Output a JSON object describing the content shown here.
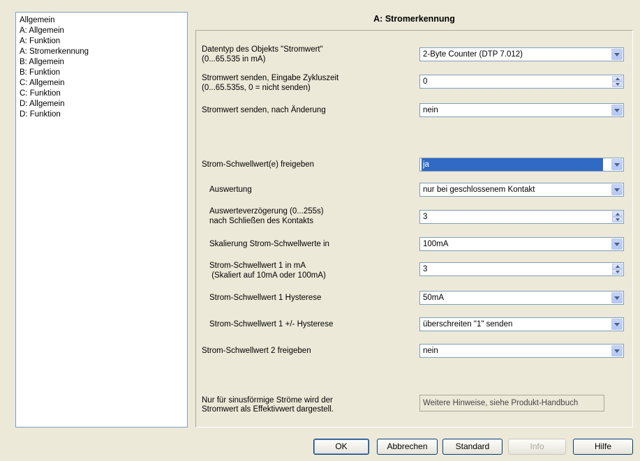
{
  "sidebar": {
    "items": [
      {
        "label": "Allgemein"
      },
      {
        "label": "A: Allgemein"
      },
      {
        "label": "A: Funktion"
      },
      {
        "label": "A: Stromerkennung"
      },
      {
        "label": "B: Allgemein"
      },
      {
        "label": "B: Funktion"
      },
      {
        "label": "C: Allgemein"
      },
      {
        "label": "C: Funktion"
      },
      {
        "label": "D: Allgemein"
      },
      {
        "label": "D: Funktion"
      }
    ]
  },
  "panel": {
    "title": "A: Stromerkennung",
    "params": [
      {
        "line1": "Datentyp des Objekts \"Stromwert\"",
        "line2": "(0...65.535 in mA)",
        "value": "2-Byte Counter (DTP 7.012)",
        "control": "dropdown"
      },
      {
        "line1": "Stromwert senden, Eingabe Zykluszeit",
        "line2": "(0...65.535s, 0 = nicht senden)",
        "value": "0",
        "control": "spinner"
      },
      {
        "line1": "Stromwert senden, nach Änderung",
        "line2": "",
        "value": "nein",
        "control": "dropdown"
      },
      {
        "line1": "Strom-Schwellwert(e) freigeben",
        "line2": "",
        "value": "ja",
        "control": "dropdown"
      },
      {
        "line1": "Auswertung",
        "line2": "",
        "value": "nur bei geschlossenem Kontakt",
        "control": "dropdown"
      },
      {
        "line1": "Auswerteverzögerung (0...255s)",
        "line2": "nach Schließen des Kontakts",
        "value": "3",
        "control": "spinner"
      },
      {
        "line1": "Skalierung Strom-Schwellwerte in",
        "line2": "",
        "value": "100mA",
        "control": "dropdown"
      },
      {
        "line1": "Strom-Schwellwert 1 in mA",
        "line2": " (Skaliert auf 10mA oder 100mA)",
        "value": "3",
        "control": "spinner"
      },
      {
        "line1": "Strom-Schwellwert 1 Hysterese",
        "line2": "",
        "value": "50mA",
        "control": "dropdown"
      },
      {
        "line1": "Strom-Schwellwert 1 +/- Hysterese",
        "line2": "",
        "value": "überschreiten \"1\" senden",
        "control": "dropdown"
      },
      {
        "line1": "Strom-Schwellwert 2 freigeben",
        "line2": "",
        "value": "nein",
        "control": "dropdown"
      }
    ],
    "note_line1": "Nur für sinusförmige Ströme wird der",
    "note_line2": "Stromwert als Effektivwert dargestell.",
    "info_text": "Weitere Hinweise, siehe Produkt-Handbuch"
  },
  "buttons": {
    "ok": "OK",
    "cancel": "Abbrechen",
    "standard": "Standard",
    "info": "Info",
    "help": "Hilfe"
  },
  "colors": {
    "background": "#ece9d8",
    "selection": "#316ac5",
    "control_border": "#7f9db9"
  }
}
